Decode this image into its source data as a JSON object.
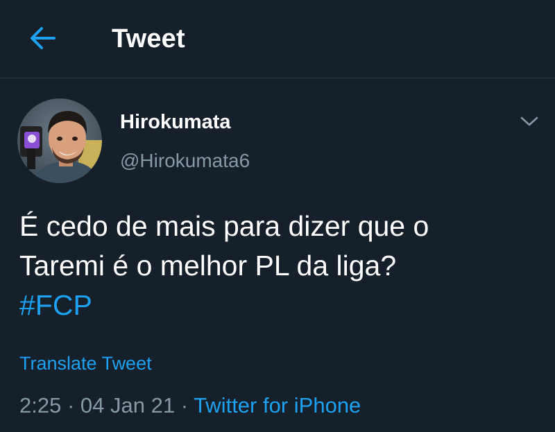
{
  "colors": {
    "background": "#15202b",
    "accent": "#1da1f2",
    "secondary_text": "#8899a6",
    "divider": "#2b3a48"
  },
  "header": {
    "back_icon": "arrow-left-icon",
    "title": "Tweet"
  },
  "author": {
    "avatar_icon": "profile-photo",
    "display_name": "Hirokumata",
    "handle": "@Hirokumata6",
    "more_icon": "chevron-down-icon"
  },
  "tweet": {
    "line1": "É cedo de mais para dizer que o",
    "line2": "Taremi é o melhor PL da liga?",
    "hashtag": "#FCP",
    "translate_label": "Translate Tweet",
    "time": "2:25",
    "separator1": " · ",
    "date": "04 Jan 21",
    "separator2": " · ",
    "source": "Twitter for iPhone"
  }
}
